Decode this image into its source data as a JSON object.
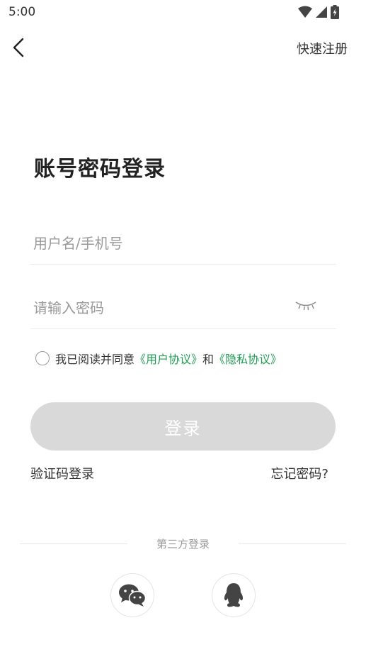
{
  "status_bar": {
    "time": "5:00"
  },
  "header": {
    "register_label": "快速注册"
  },
  "title": "账号密码登录",
  "form": {
    "username_placeholder": "用户名/手机号",
    "password_placeholder": "请输入密码"
  },
  "agreement": {
    "prefix": "我已阅读并同意",
    "user_agreement": "《用户协议》",
    "and": "和",
    "privacy_agreement": "《隐私协议》"
  },
  "login_button": "登录",
  "links": {
    "sms_login": "验证码登录",
    "forgot_password": "忘记密码?"
  },
  "third_party": {
    "label": "第三方登录",
    "providers": [
      "wechat-icon",
      "qq-icon"
    ]
  },
  "colors": {
    "link_green": "#1f9d55",
    "button_disabled": "#d9d9d9"
  }
}
